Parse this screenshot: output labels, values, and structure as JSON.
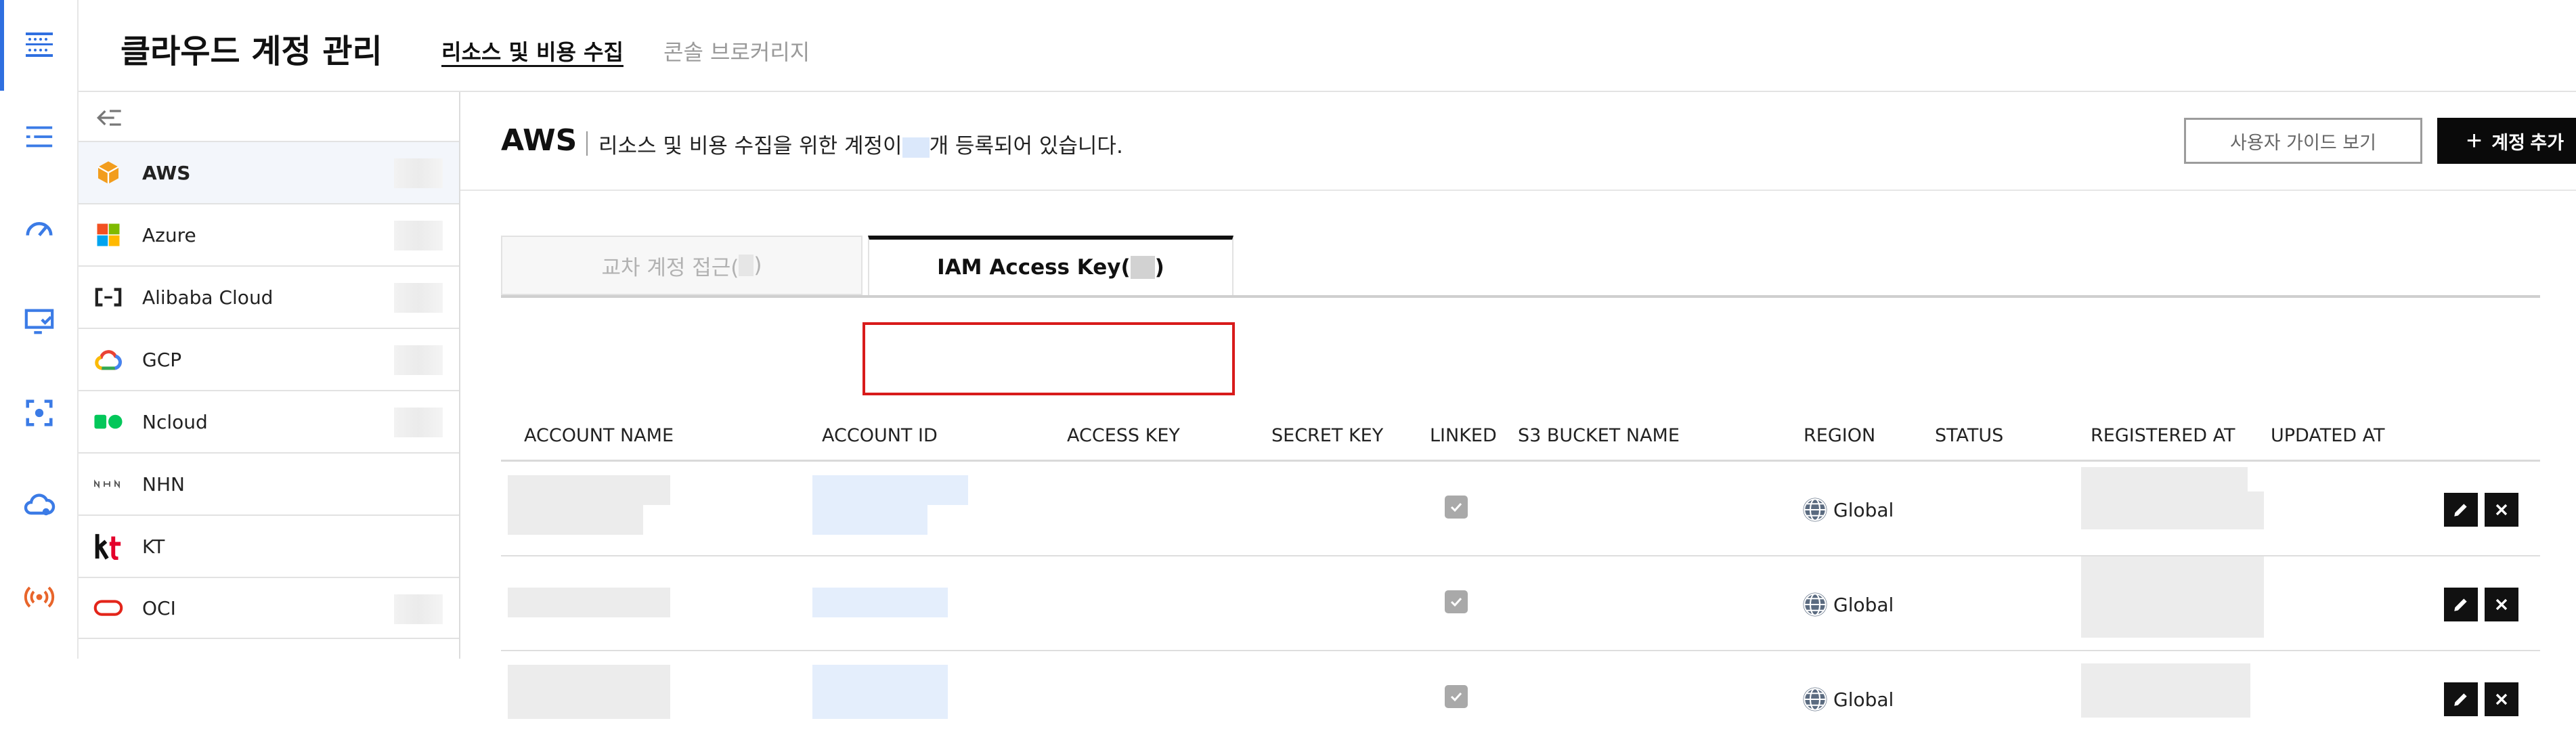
{
  "app": {
    "title": "클라우드 계정 관리",
    "tabs": [
      {
        "label": "리소스 및 비용 수집",
        "active": true
      },
      {
        "label": "콘솔 브로커리지",
        "active": false
      }
    ]
  },
  "rail_icons": [
    "grid-menu-icon",
    "list-icon",
    "gauge-icon",
    "monitor-check-icon",
    "scan-icon",
    "cloud-gear-icon",
    "broadcast-icon"
  ],
  "sidebar": {
    "collapse_icon": "collapse-left-icon",
    "providers": [
      {
        "id": "aws",
        "label": "AWS",
        "active": true
      },
      {
        "id": "azure",
        "label": "Azure"
      },
      {
        "id": "alibaba",
        "label": "Alibaba Cloud"
      },
      {
        "id": "gcp",
        "label": "GCP"
      },
      {
        "id": "ncloud",
        "label": "Ncloud"
      },
      {
        "id": "nhn",
        "label": "NHN"
      },
      {
        "id": "kt",
        "label": "KT"
      },
      {
        "id": "oci",
        "label": "OCI"
      }
    ]
  },
  "main": {
    "provider_title": "AWS",
    "description_before": "리소스 및 비용 수집을 위한 계정이",
    "description_after": "개 등록되어 있습니다.",
    "guide_button": "사용자 가이드 보기",
    "add_button": "계정 추가",
    "subtabs": [
      {
        "label": "교차 계정 접근(",
        "suffix": ")",
        "active": false
      },
      {
        "label": "IAM Access Key(",
        "suffix": ")",
        "active": true
      }
    ],
    "table": {
      "columns": [
        "ACCOUNT NAME",
        "ACCOUNT ID",
        "ACCESS KEY",
        "SECRET KEY",
        "LINKED",
        "S3 BUCKET NAME",
        "REGION",
        "STATUS",
        "REGISTERED AT",
        "UPDATED AT"
      ],
      "rows": [
        {
          "linked": true,
          "region": "Global"
        },
        {
          "linked": true,
          "region": "Global"
        },
        {
          "linked": true,
          "region": "Global"
        }
      ]
    }
  },
  "colors": {
    "accent": "#2f6fe0",
    "rail_icon": "#3b7be6",
    "rail_icon_alert": "#e8652b",
    "highlight_border": "#d81b1b",
    "primary_button": "#0a0a0a"
  }
}
